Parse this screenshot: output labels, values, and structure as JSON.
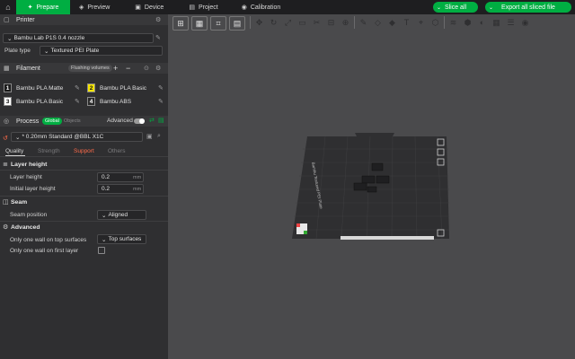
{
  "topbar": {
    "tabs": [
      {
        "label": "Prepare",
        "icon": "home-icon"
      },
      {
        "label": "Preview",
        "icon": "preview-icon"
      },
      {
        "label": "Device",
        "icon": "device-icon"
      },
      {
        "label": "Project",
        "icon": "project-icon"
      },
      {
        "label": "Calibration",
        "icon": "calibration-icon"
      }
    ],
    "slice_all": "Slice all",
    "export": "Export all sliced file"
  },
  "printer": {
    "header": "Printer",
    "name": "Bambu Lab P1S 0.4 nozzle",
    "plate_type_label": "Plate type",
    "plate_type_value": "Textured PEI Plate"
  },
  "filament": {
    "header": "Filament",
    "flushing_label": "Flushing volumes",
    "items": [
      {
        "num": "1",
        "name": "Bambu PLA Matte",
        "color": "#1b1b1b",
        "text": "#ffffff"
      },
      {
        "num": "2",
        "name": "Bambu PLA Basic",
        "color": "#f5e400",
        "text": "#111111"
      },
      {
        "num": "3",
        "name": "Bambu PLA Basic",
        "color": "#ffffff",
        "text": "#111111"
      },
      {
        "num": "4",
        "name": "Bambu ABS",
        "color": "#2a2a2a",
        "text": "#ffffff"
      }
    ]
  },
  "process": {
    "header": "Process",
    "global_label": "Global",
    "objects_label": "Objects",
    "advanced_label": "Advanced",
    "profile": "* 0.20mm Standard @BBL X1C",
    "subtabs": [
      "Quality",
      "Strength",
      "Support",
      "Others"
    ],
    "layer_height_title": "Layer height",
    "layer_height_label": "Layer height",
    "layer_height_value": "0.2",
    "initial_layer_label": "Initial layer height",
    "initial_layer_value": "0.2",
    "unit": "mm",
    "seam_title": "Seam",
    "seam_position_label": "Seam position",
    "seam_position_value": "Aligned",
    "advanced_title": "Advanced",
    "wall_top_label": "Only one wall on top surfaces",
    "wall_top_value": "Top surfaces",
    "wall_first_label": "Only one wall on first layer"
  },
  "plate": {
    "label": "Bambu Textured PEI Plate"
  }
}
